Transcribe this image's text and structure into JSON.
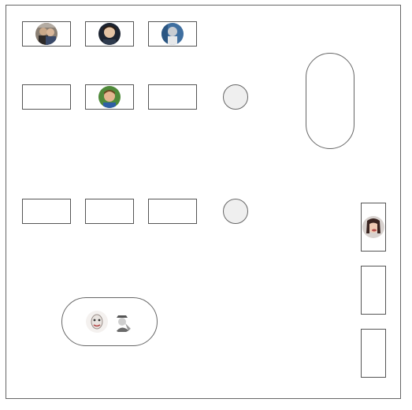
{
  "floor_plan": {
    "occupied_desks": [
      {
        "row": 1,
        "col": 1,
        "avatar": "avatar-group-icon"
      },
      {
        "row": 1,
        "col": 2,
        "avatar": "avatar-boy-icon"
      },
      {
        "row": 1,
        "col": 3,
        "avatar": "avatar-man-icon"
      },
      {
        "row": 2,
        "col": 2,
        "avatar": "avatar-child-icon"
      }
    ],
    "vertical_desk_avatar": "avatar-woman-icon",
    "meeting_pod_avatars": [
      "avatar-painted-face-icon",
      "avatar-sketch-icon"
    ],
    "colors": {
      "border": "#555555",
      "round_table": "#efefef"
    }
  }
}
